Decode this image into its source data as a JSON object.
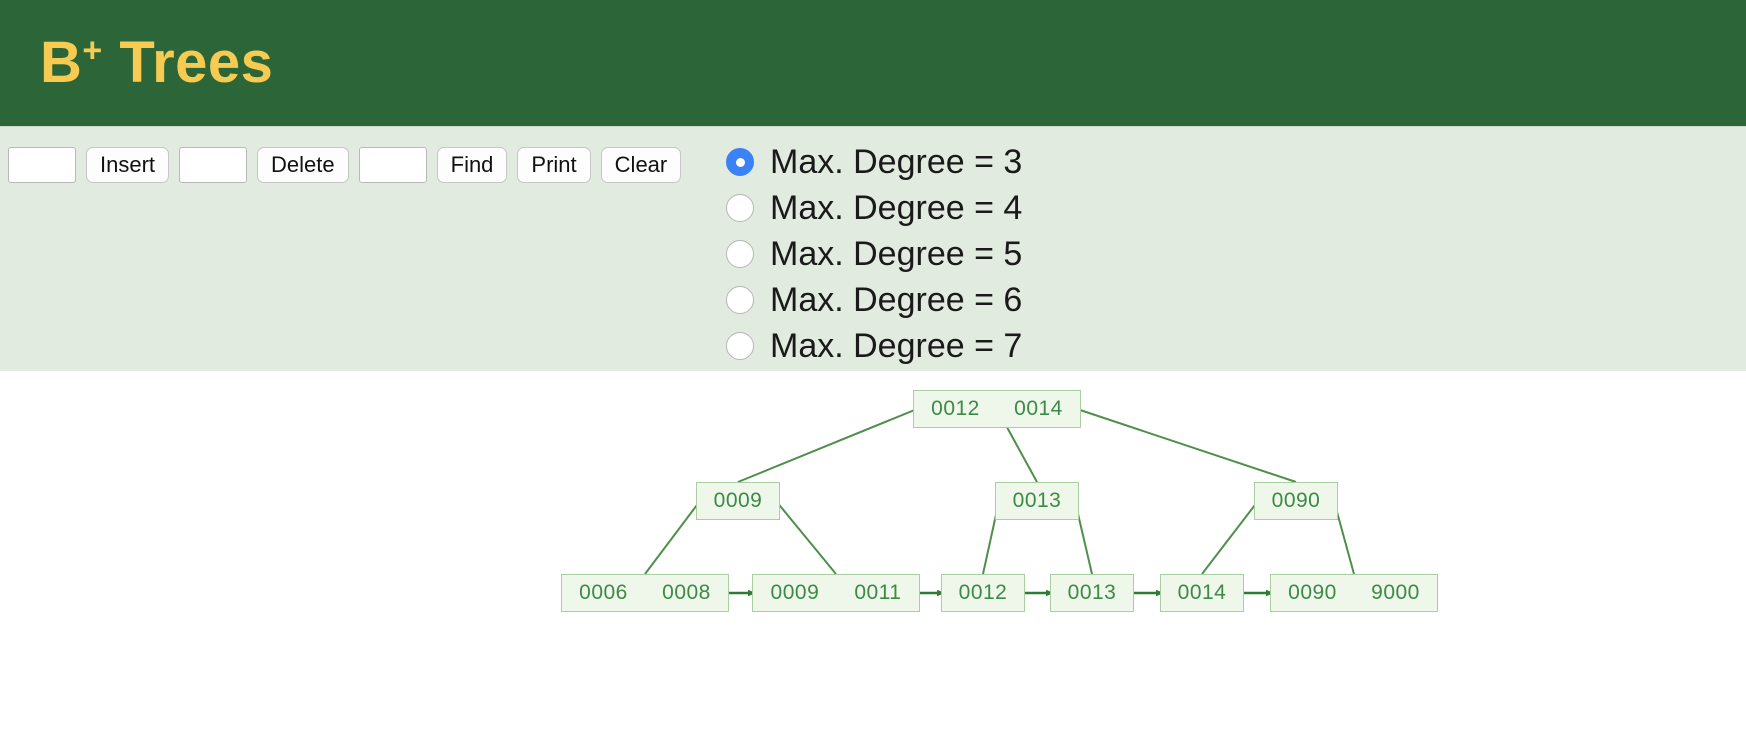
{
  "header": {
    "title_base": "B",
    "title_sup": "+",
    "title_rest": " Trees"
  },
  "toolbar": {
    "insert_value": "",
    "insert_placeholder": "",
    "insert_label": "Insert",
    "delete_value": "",
    "delete_placeholder": "",
    "delete_label": "Delete",
    "find_value": "",
    "find_placeholder": "",
    "find_label": "Find",
    "print_label": "Print",
    "clear_label": "Clear"
  },
  "degree_options": [
    {
      "label": "Max. Degree = 3",
      "selected": true
    },
    {
      "label": "Max. Degree = 4",
      "selected": false
    },
    {
      "label": "Max. Degree = 5",
      "selected": false
    },
    {
      "label": "Max. Degree = 6",
      "selected": false
    },
    {
      "label": "Max. Degree = 7",
      "selected": false
    }
  ],
  "colors": {
    "header_bg": "#2c6638",
    "header_text": "#f7ca52",
    "toolbar_bg": "#e2ebe0",
    "node_fill": "#eef7ea",
    "node_border": "#a9cea0",
    "node_text": "#3c8a46",
    "edge": "#4f8f4a",
    "radio_selected": "#3b82f6"
  },
  "tree": {
    "root": {
      "keys": [
        "0012",
        "0014"
      ]
    },
    "internal": [
      {
        "keys": [
          "0009"
        ]
      },
      {
        "keys": [
          "0013"
        ]
      },
      {
        "keys": [
          "0090"
        ]
      }
    ],
    "leaves": [
      {
        "keys": [
          "0006",
          "0008"
        ]
      },
      {
        "keys": [
          "0009",
          "0011"
        ]
      },
      {
        "keys": [
          "0012"
        ]
      },
      {
        "keys": [
          "0013"
        ]
      },
      {
        "keys": [
          "0014"
        ]
      },
      {
        "keys": [
          "0090",
          "9000"
        ]
      }
    ]
  }
}
